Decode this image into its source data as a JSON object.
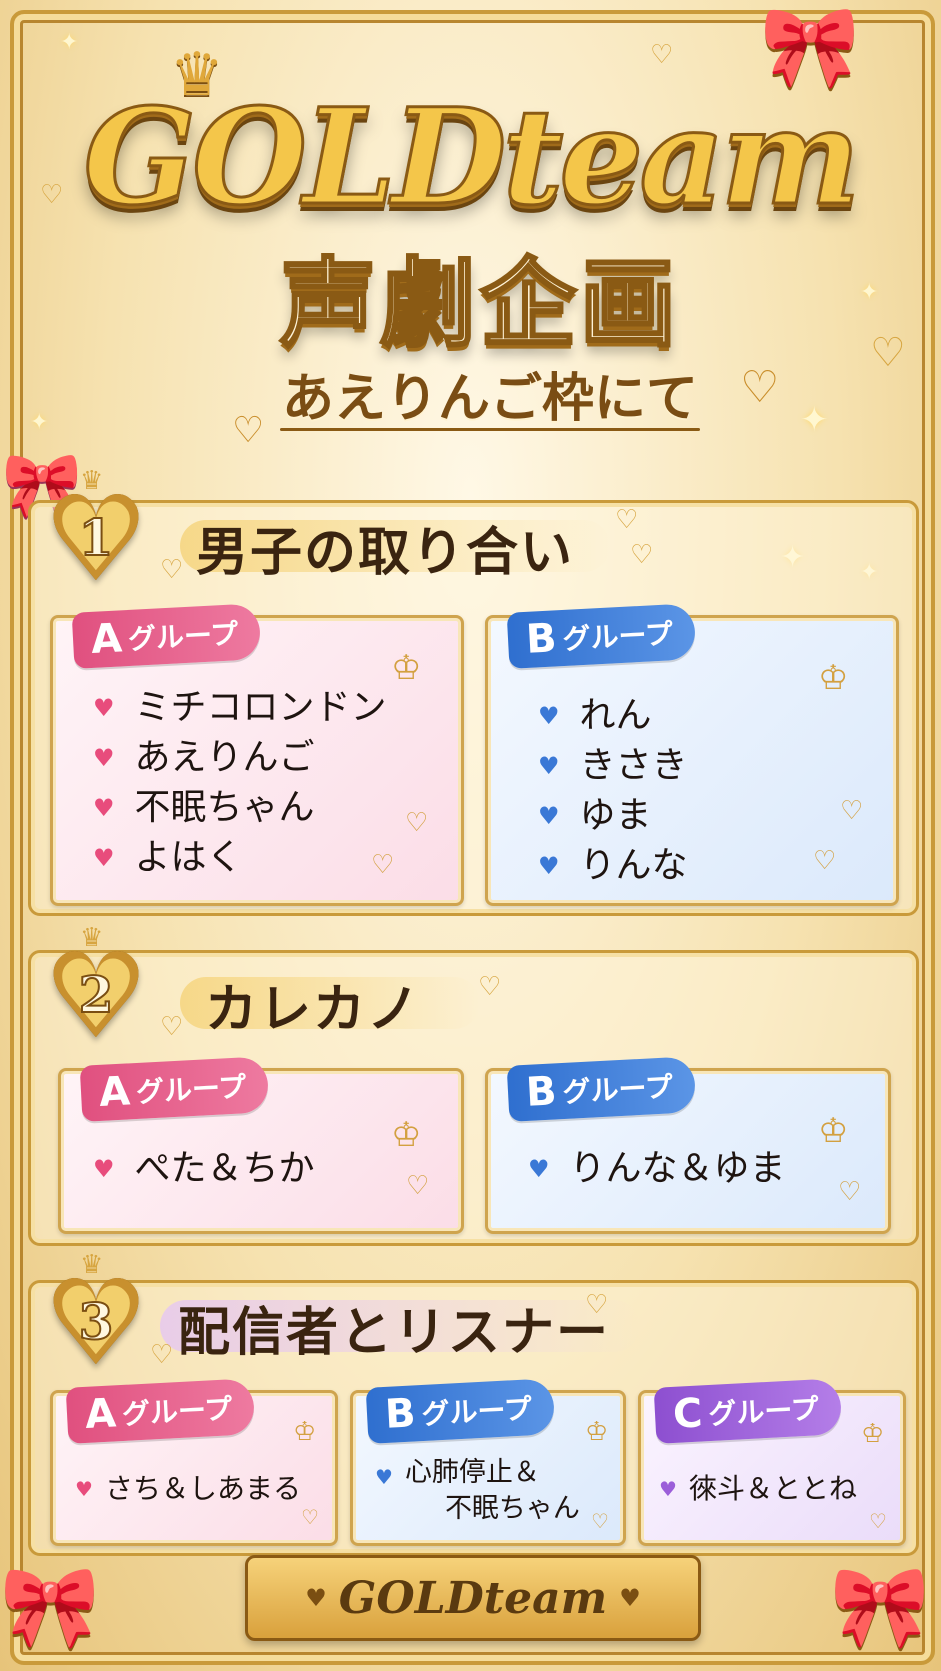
{
  "title": {
    "brand": "GOLDteam",
    "main": "声劇企画",
    "subtitle": "あえりんご枠にて"
  },
  "sections": [
    {
      "number": "1",
      "title": "男子の取り合い",
      "groups": [
        {
          "letter": "A",
          "label": "グループ",
          "color": "pink",
          "members": [
            "ミチコロンドン",
            "あえりんご",
            "不眠ちゃん",
            "よはく"
          ]
        },
        {
          "letter": "B",
          "label": "グループ",
          "color": "blue",
          "members": [
            "れん",
            "きさき",
            "ゆま",
            "りんな"
          ]
        }
      ]
    },
    {
      "number": "2",
      "title": "カレカノ",
      "groups": [
        {
          "letter": "A",
          "label": "グループ",
          "color": "pink",
          "members": [
            "ぺた＆ちか"
          ]
        },
        {
          "letter": "B",
          "label": "グループ",
          "color": "blue",
          "members": [
            "りんな＆ゆま"
          ]
        }
      ]
    },
    {
      "number": "3",
      "title": "配信者とリスナー",
      "groups": [
        {
          "letter": "A",
          "label": "グループ",
          "color": "pink",
          "members": [
            "さち＆しあまる"
          ]
        },
        {
          "letter": "B",
          "label": "グループ",
          "color": "blue",
          "members": [
            "心肺停止＆",
            "不眠ちゃん"
          ]
        },
        {
          "letter": "C",
          "label": "グループ",
          "color": "purple",
          "members": [
            "徠斗＆ととね"
          ]
        }
      ]
    }
  ],
  "footer": {
    "brand": "GOLDteam"
  },
  "colors": {
    "gold": "#c99a3a",
    "pink": "#e84c7c",
    "blue": "#3a78d6",
    "purple": "#9b5ed9"
  }
}
